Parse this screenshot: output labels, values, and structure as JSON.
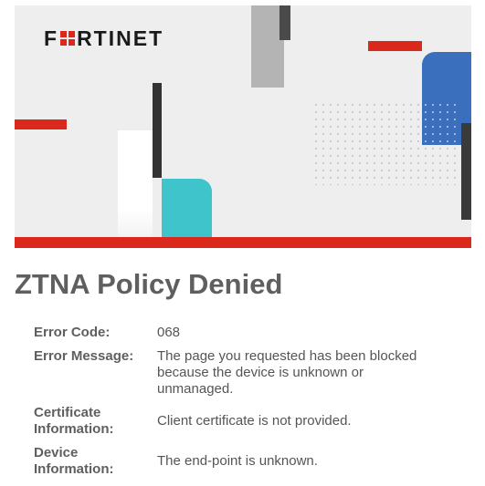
{
  "brand": {
    "logo_text_left": "F",
    "logo_text_right": "RTINET",
    "logo_icon": "fortinet-grid-o-icon",
    "accent_color": "#da291c"
  },
  "page": {
    "title": "ZTNA Policy Denied"
  },
  "details": [
    {
      "label": "Error Code:",
      "value": "068"
    },
    {
      "label": "Error Message:",
      "value": "The page you requested has been blocked because the device is unknown or unmanaged."
    },
    {
      "label": "Certificate Information:",
      "value": "Client certificate is not provided."
    },
    {
      "label": "Device Information:",
      "value": "The end-point is unknown."
    }
  ]
}
